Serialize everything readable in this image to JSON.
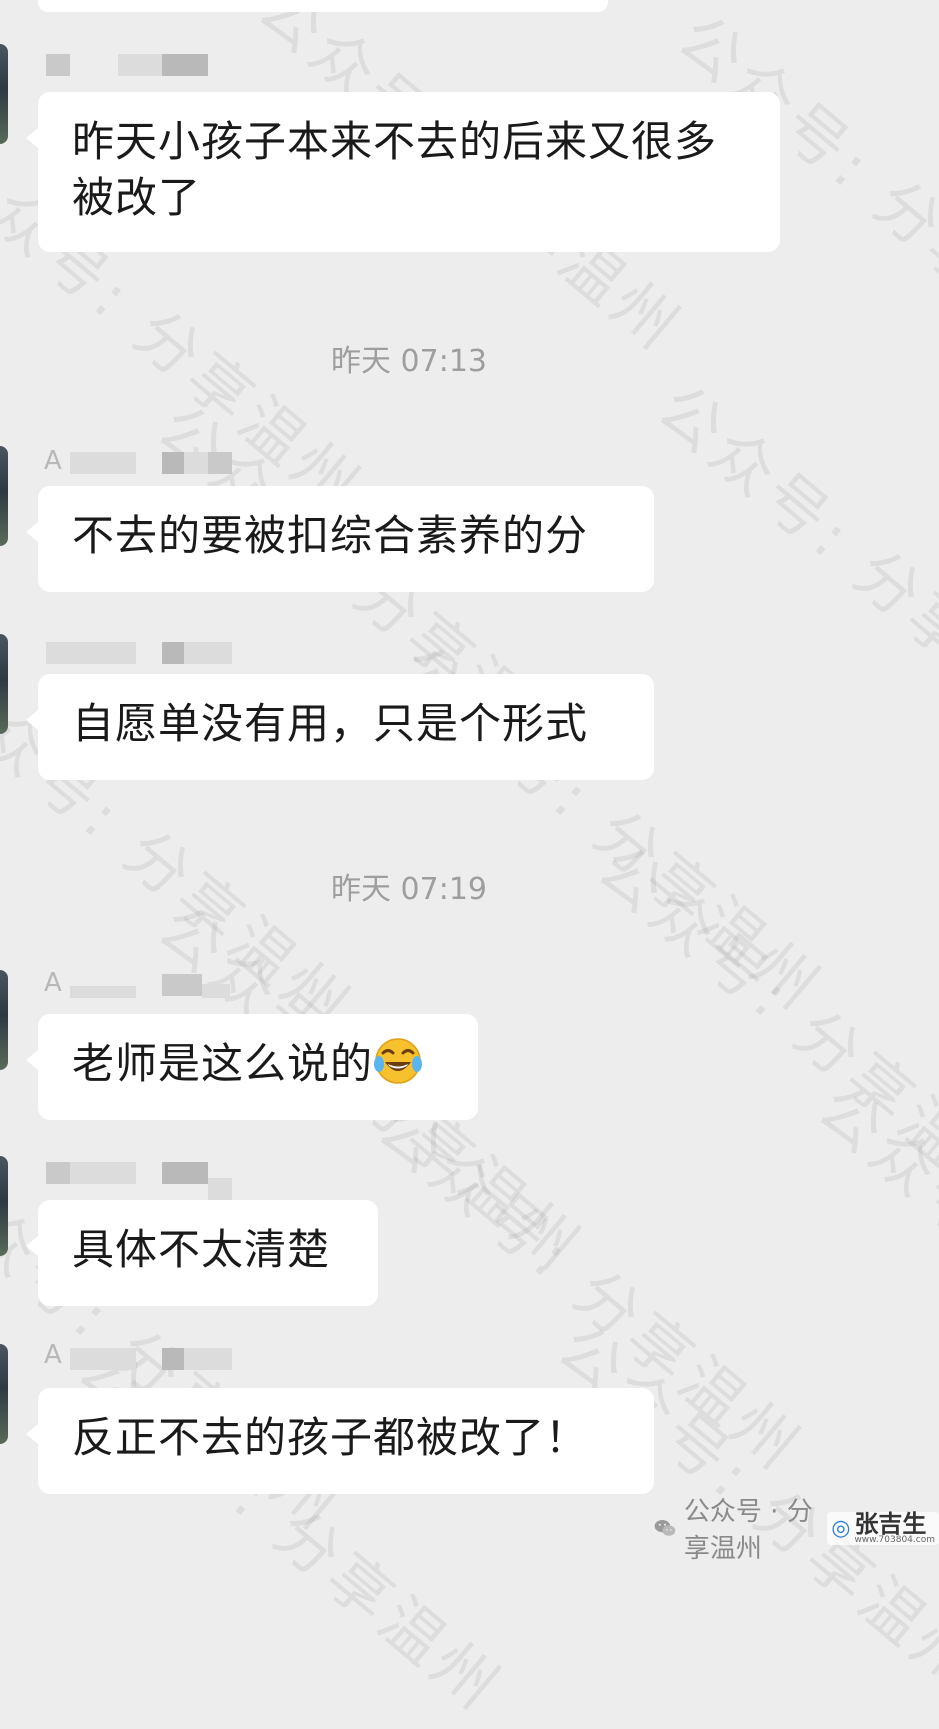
{
  "messages": [
    {
      "text": "昨天小孩子本来不去的后来又很多被改了"
    },
    {
      "text": "不去的要被扣综合素养的分"
    },
    {
      "text": "自愿单没有用，只是个形式"
    },
    {
      "text": "老师是这么说的"
    },
    {
      "text": "具体不太清楚"
    },
    {
      "text": "反正不去的孩子都被改了！"
    }
  ],
  "timestamps": [
    "昨天 07:13",
    "昨天 07:19"
  ],
  "sender_initials": {
    "second": "A",
    "fourth": "A",
    "sixth": "A"
  },
  "emoji_icon": "face-with-tears-of-joy-icon",
  "watermark": {
    "text": "公众号: 分享温州"
  },
  "footer": {
    "label": "公众号 · 分享温州",
    "logo_title": "张吉生",
    "logo_url": "www.703804.com"
  }
}
